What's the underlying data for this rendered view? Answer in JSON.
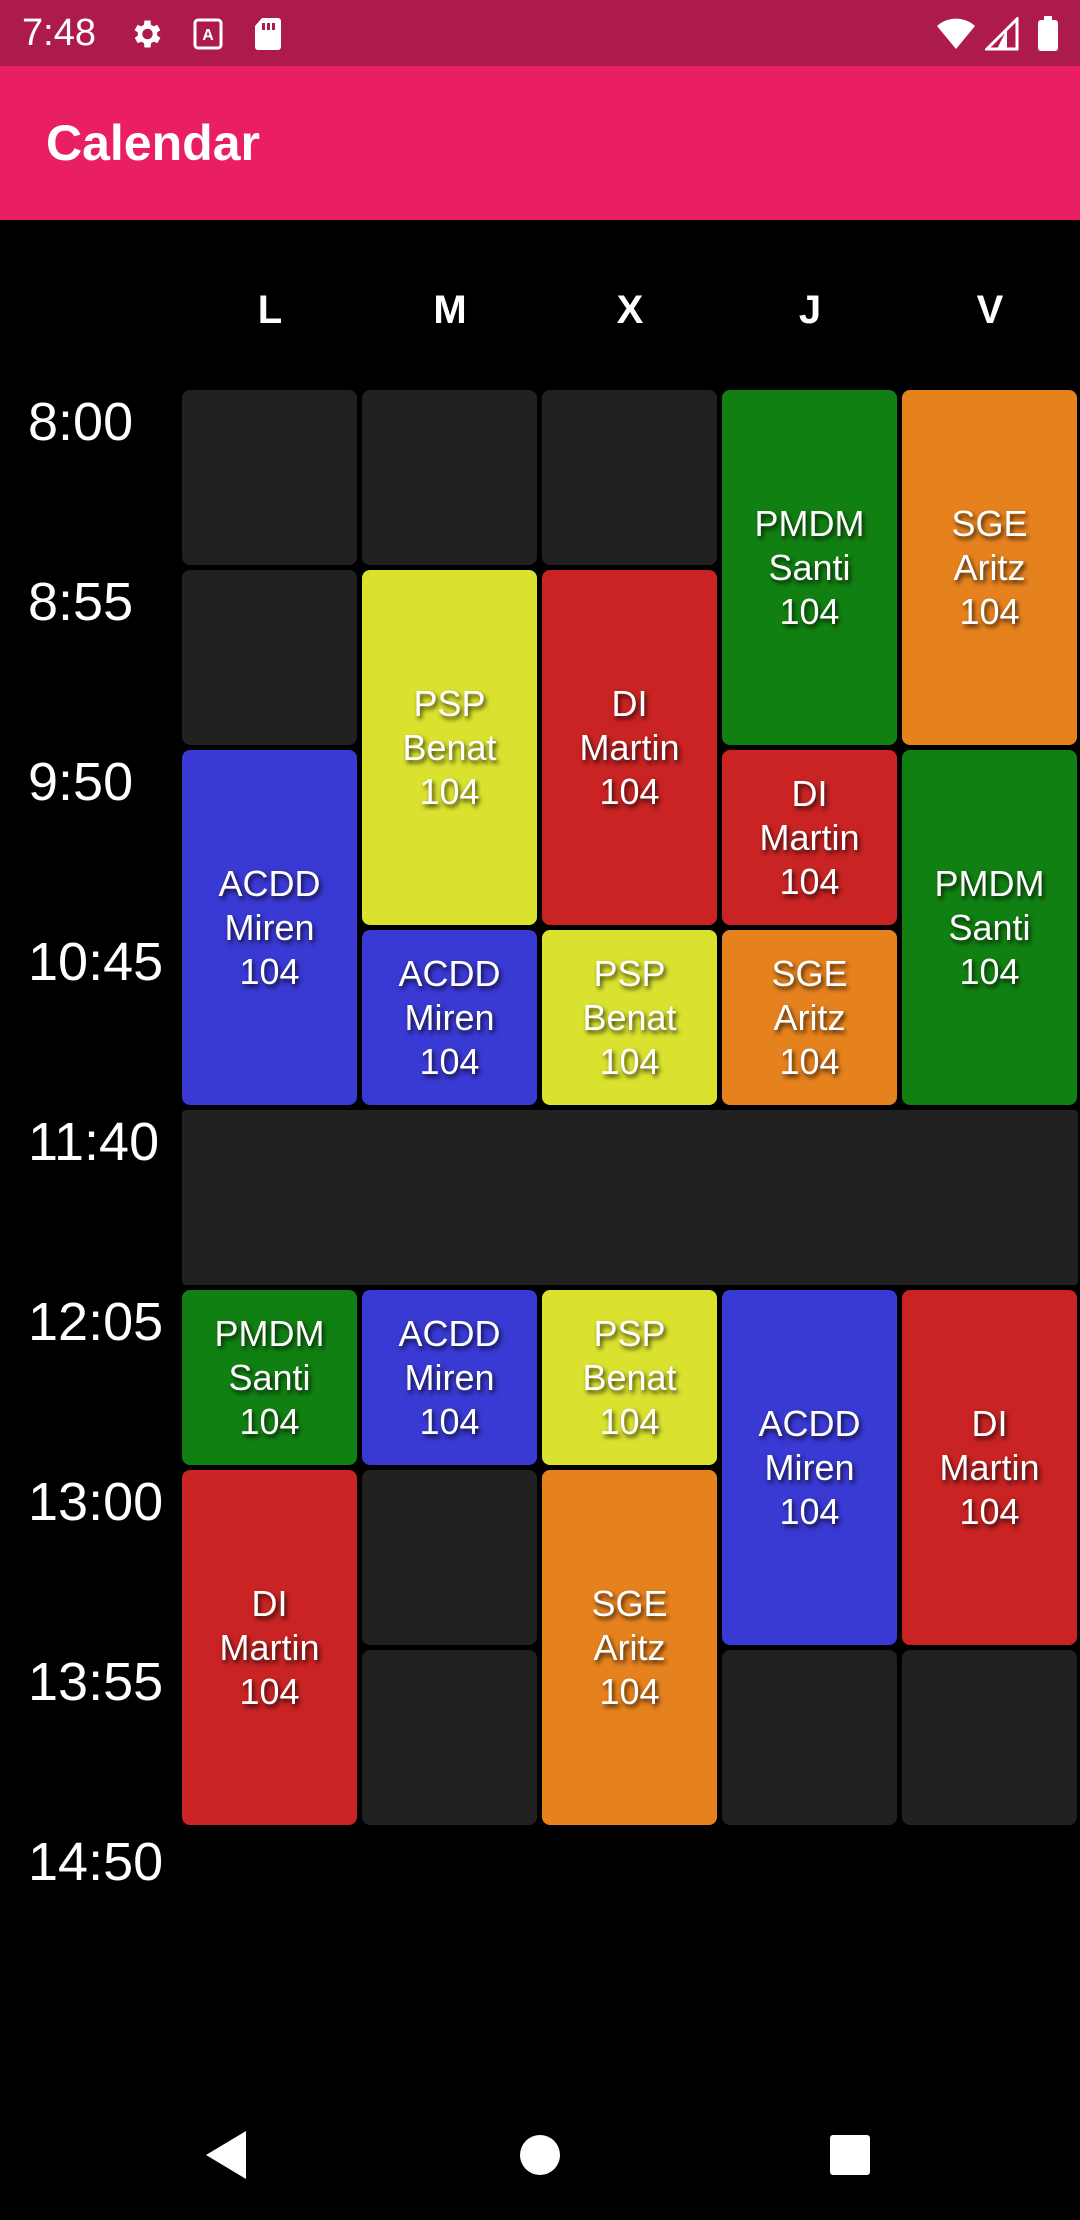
{
  "status_bar": {
    "time": "7:48",
    "icons": [
      "gear-icon",
      "a-icon",
      "sim-card-icon",
      "wifi-icon",
      "signal-icon",
      "battery-icon"
    ]
  },
  "app_bar": {
    "title": "Calendar"
  },
  "days": [
    "L",
    "M",
    "X",
    "J",
    "V"
  ],
  "times": [
    "8:00",
    "8:55",
    "9:50",
    "10:45",
    "11:40",
    "12:05",
    "13:00",
    "13:55",
    "14:50"
  ],
  "colors": {
    "empty": "#212121",
    "green": "#118012",
    "orange": "#E6821E",
    "yellow": "#DAE22F",
    "red": "#C92323",
    "blue": "#3939D3",
    "status_bar": "#AD1A4E",
    "app_bar": "#E91E63"
  },
  "schedule": [
    {
      "subject": "PMDM",
      "teacher": "Santi",
      "room": "104"
    },
    {
      "subject": "SGE",
      "teacher": "Aritz",
      "room": "104"
    },
    {
      "subject": "PSP",
      "teacher": "Benat",
      "room": "104"
    },
    {
      "subject": "DI",
      "teacher": "Martin",
      "room": "104"
    },
    {
      "subject": "ACDD",
      "teacher": "Miren",
      "room": "104"
    },
    {
      "subject": "DI",
      "teacher": "Martin",
      "room": "104"
    },
    {
      "subject": "PMDM",
      "teacher": "Santi",
      "room": "104"
    },
    {
      "subject": "ACDD",
      "teacher": "Miren",
      "room": "104"
    },
    {
      "subject": "PSP",
      "teacher": "Benat",
      "room": "104"
    },
    {
      "subject": "SGE",
      "teacher": "Aritz",
      "room": "104"
    },
    {
      "subject": "PMDM",
      "teacher": "Santi",
      "room": "104"
    },
    {
      "subject": "ACDD",
      "teacher": "Miren",
      "room": "104"
    },
    {
      "subject": "PSP",
      "teacher": "Benat",
      "room": "104"
    },
    {
      "subject": "ACDD",
      "teacher": "Miren",
      "room": "104"
    },
    {
      "subject": "DI",
      "teacher": "Martin",
      "room": "104"
    },
    {
      "subject": "DI",
      "teacher": "Martin",
      "room": "104"
    },
    {
      "subject": "SGE",
      "teacher": "Aritz",
      "room": "104"
    }
  ],
  "nav_bar": {
    "icons": [
      "back-icon",
      "home-icon",
      "recents-icon"
    ]
  }
}
